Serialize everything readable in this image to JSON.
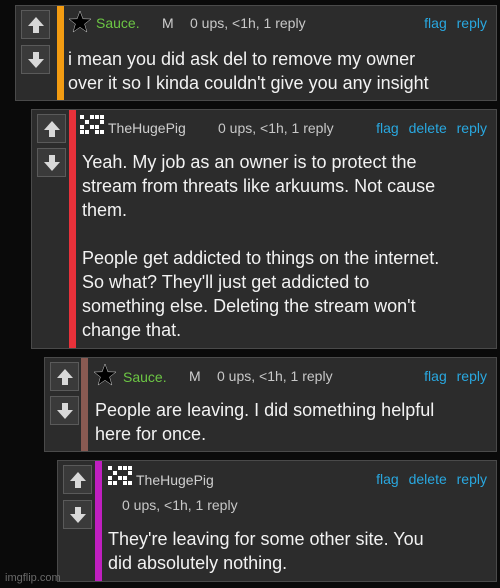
{
  "comments": [
    {
      "username": "Sauce.",
      "mod_badge": "M",
      "meta": "0 ups, <1h, 1 reply",
      "actions": [
        "flag",
        "reply"
      ],
      "text": "i mean you did ask del to remove my owner\nover it so I kinda couldn't give you any insight",
      "bar_color": "#f39c12"
    },
    {
      "username": "TheHugePig",
      "meta": "0 ups, <1h, 1 reply",
      "actions": [
        "flag",
        "delete",
        "reply"
      ],
      "text": "Yeah. My job as an owner is to protect the\nstream from threats like arkuums. Not cause\nthem.\n\nPeople get addicted to things on the internet.\nSo what? They'll just get addicted to\nsomething else. Deleting the stream won't\nchange that.",
      "bar_color": "#e8313a"
    },
    {
      "username": "Sauce.",
      "mod_badge": "M",
      "meta": "0 ups, <1h, 1 reply",
      "actions": [
        "flag",
        "reply"
      ],
      "text": "People are leaving. I did something helpful\nhere for once.",
      "bar_color": "#8a5a52"
    },
    {
      "username": "TheHugePig",
      "meta": "0 ups, <1h, 1 reply",
      "actions": [
        "flag",
        "delete",
        "reply"
      ],
      "text": "They're leaving for some other site. You\ndid absolutely nothing.",
      "bar_color": "#c01fc0"
    }
  ],
  "watermark": "imgflip.com"
}
